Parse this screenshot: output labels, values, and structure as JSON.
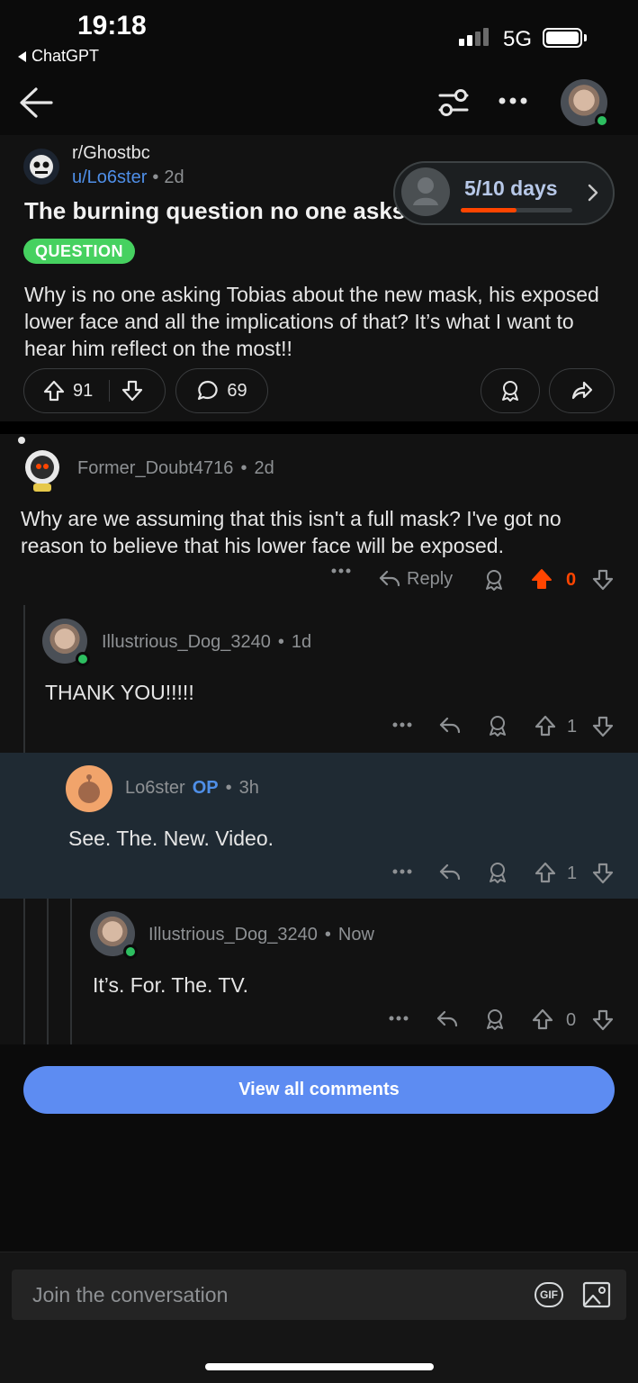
{
  "status_bar": {
    "time": "19:18",
    "back_app": "ChatGPT",
    "network": "5G"
  },
  "post": {
    "subreddit": "r/Ghostbc",
    "author": "u/Lo6ster",
    "age": "2d",
    "title": "The burning question no one asks",
    "flair": "QUESTION",
    "body": "Why is no one asking Tobias about the new mask, his exposed lower face and all the implications of that? It’s what I want to hear him reflect on the most!!",
    "upvotes": "91",
    "comments": "69"
  },
  "streak": {
    "label": "5/10 days",
    "progress": 0.5
  },
  "comments": [
    {
      "username": "Former_Doubt4716",
      "age": "2d",
      "body": "Why are we assuming that this isn't a full mask? I've got no reason to believe that his lower face will be exposed.",
      "reply_label": "Reply",
      "score": "0"
    },
    {
      "username": "Illustrious_Dog_3240",
      "age": "1d",
      "body": "THANK YOU!!!!!",
      "score": "1"
    },
    {
      "username": "Lo6ster",
      "op": "OP",
      "age": "3h",
      "body": "See. The. New. Video.",
      "score": "1"
    },
    {
      "username": "Illustrious_Dog_3240",
      "age": "Now",
      "body": "It’s. For. The. TV.",
      "score": "0"
    }
  ],
  "view_all_label": "View all comments",
  "composer": {
    "placeholder": "Join the conversation",
    "gif_label": "GIF"
  },
  "colors": {
    "accent_blue": "#5d8cf2",
    "upvote_orange": "#ff4500",
    "flair_green": "#46d160",
    "online_green": "#2dbe60"
  }
}
